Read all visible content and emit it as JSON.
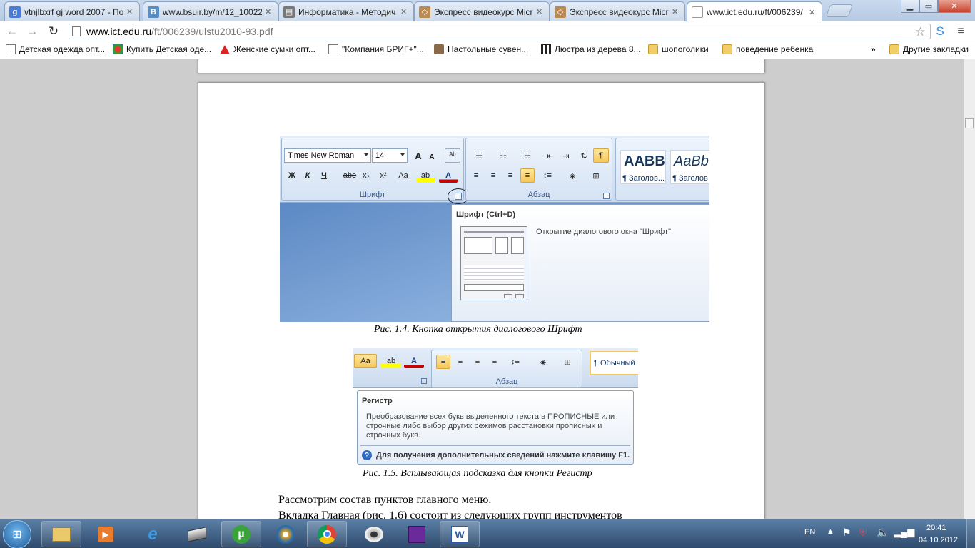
{
  "tabs": [
    {
      "title": "vtnjlbxrf gj word 2007 - По",
      "fav": "g",
      "color": "#4a7bd6"
    },
    {
      "title": "www.bsuir.by/m/12_10022",
      "fav": "B",
      "color": "#5a8fc4"
    },
    {
      "title": "Информатика - Методич",
      "fav": "▤",
      "color": "#777777"
    },
    {
      "title": "Экспресс видеокурс Micr",
      "fav": "◇",
      "color": "#b98a52"
    },
    {
      "title": "Экспресс видеокурс Micr",
      "fav": "◇",
      "color": "#b98a52"
    },
    {
      "title": "www.ict.edu.ru/ft/006239/",
      "fav": "",
      "color": "#ffffff",
      "active": true
    }
  ],
  "address": {
    "host": "www.ict.edu.ru",
    "path": "/ft/006239/ulstu2010-93.pdf"
  },
  "bookmarks": [
    "Детская одежда опт...",
    "Купить Детская оде...",
    "Женские сумки опт...",
    "\"Компания БРИГ+\"...",
    "Настольные сувен...",
    "Люстра из дерева 8...",
    "шопоголики",
    "поведение ребенка"
  ],
  "bookmarks_more": "»",
  "bookmarks_other": "Другие закладки",
  "ribbon1": {
    "font_name": "Times New Roman",
    "font_size": "14",
    "group_font": "Шрифт",
    "group_para": "Абзац",
    "bold": "Ж",
    "italic": "К",
    "underline": "Ч",
    "strike": "abe",
    "subscript": "x₂",
    "superscript": "x²",
    "case": "Aa",
    "grow": "A",
    "shrink": "A",
    "style1_preview": "AABB",
    "style1_name": "¶ Заголов...",
    "style2_preview": "AaBb(",
    "style2_name": "¶ Заголов"
  },
  "tooltip1": {
    "title": "Шрифт (Ctrl+D)",
    "text": "Открытие диалогового окна \"Шрифт\"."
  },
  "caption1": "Рис. 1.4.  Кнопка открытия диалогового Шрифт",
  "ribbon2": {
    "group_para": "Абзац",
    "style_name": "¶ Обычный",
    "case": "Aa"
  },
  "tooltip2": {
    "title": "Регистр",
    "line1": "Преобразование всех букв выделенного текста в ПРОПИСНЫЕ или",
    "line2": "строчные либо выбор других режимов расстановки прописных и",
    "line3": "строчных букв.",
    "help": "Для получения дополнительных сведений нажмите клавишу F1."
  },
  "caption2": "Рис. 1.5. Всплывающая подсказка для кнопки Регистр",
  "body_line1": "Рассмотрим состав пунктов главного меню.",
  "body_line2": "Вкладка  Главная  (рис.  1.6)  состоит  из  следующих  групп  инструментов",
  "tray": {
    "lang": "EN",
    "time": "20:41",
    "date": "04.10.2012"
  },
  "colors": {
    "accent": "#4a7bd6",
    "ribbon": "#dbe6f4",
    "highlight": "#f7c75a"
  }
}
